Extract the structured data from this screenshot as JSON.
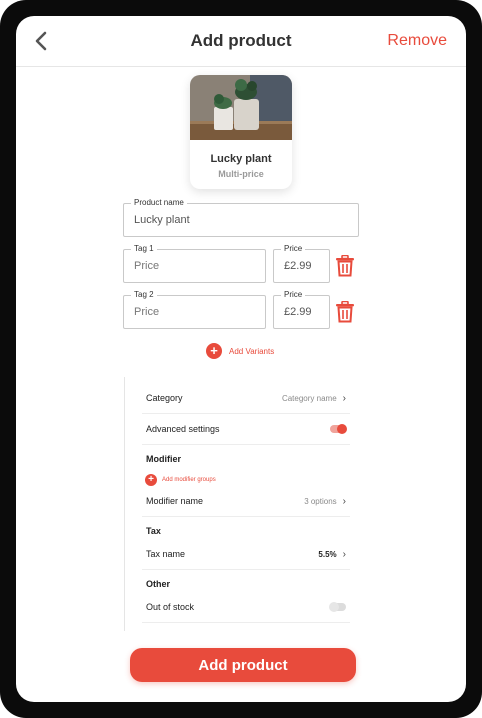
{
  "header": {
    "title": "Add product",
    "remove_label": "Remove"
  },
  "product": {
    "name": "Lucky plant",
    "subtitle": "Multi-price"
  },
  "form": {
    "product_name_label": "Product name",
    "product_name_value": "Lucky plant",
    "variants": [
      {
        "tag_label": "Tag 1",
        "tag_placeholder": "Price",
        "price_label": "Price",
        "price_value": "£2.99"
      },
      {
        "tag_label": "Tag 2",
        "tag_placeholder": "Price",
        "price_label": "Price",
        "price_value": "£2.99"
      }
    ],
    "add_variants_label": "Add Variants"
  },
  "settings": {
    "category": {
      "label": "Category",
      "value": "Category name"
    },
    "advanced": {
      "label": "Advanced settings",
      "enabled": true
    },
    "modifier": {
      "heading": "Modifier",
      "add_label": "Add modifier groups",
      "row_label": "Modifier name",
      "row_value": "3 options"
    },
    "tax": {
      "heading": "Tax",
      "row_label": "Tax name",
      "row_value": "5.5%"
    },
    "other": {
      "heading": "Other",
      "out_of_stock_label": "Out of stock",
      "out_of_stock_enabled": false
    }
  },
  "cta": {
    "label": "Add product"
  },
  "colors": {
    "accent": "#e84b3c",
    "text": "#333333",
    "border": "#c9c9c9"
  },
  "icons": [
    "chevron-left-icon",
    "trash-icon",
    "plus-icon",
    "chevron-right-icon"
  ]
}
